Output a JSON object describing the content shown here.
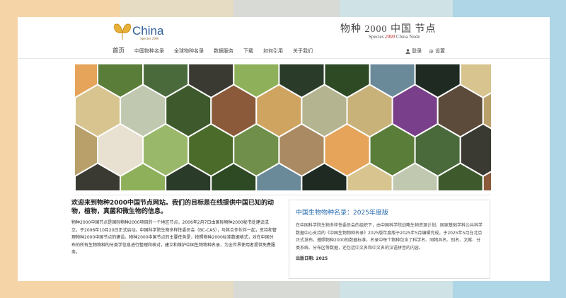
{
  "header": {
    "logo": {
      "text": "China",
      "subtitle": "Species 2000"
    },
    "brand": {
      "title": "物种 2000 中国 节点",
      "subtitle_prefix": "Species",
      "subtitle_num": "2000",
      "subtitle_suffix": "China Node"
    }
  },
  "nav": {
    "items": [
      "首页",
      "中国物种名录",
      "全球物种名录",
      "数据服务",
      "下载",
      "如何引用",
      "关于我们"
    ],
    "login": "登录",
    "settings": "设置"
  },
  "banner": {
    "colors": [
      "#3e5a2c",
      "#b9a06a",
      "#5b7d3a",
      "#1e2a22",
      "#c9b27a",
      "#6f8f4a",
      "#2b3b2a",
      "#8a5a3a",
      "#e8e0d0",
      "#4a6a3c",
      "#d7c48f",
      "#7a3f8a",
      "#a98a62",
      "#2d4a24",
      "#cfa460",
      "#9ab86a",
      "#3a3a32",
      "#c0c8b0",
      "#5c4a3a",
      "#e6a45a",
      "#6a8a9a",
      "#b4b490",
      "#4b6b2b",
      "#8fb05a"
    ]
  },
  "welcome": {
    "title": "欢迎来到物种2000中国节点网站。我们的目标是在线提供中国已知的动物，植物，真菌和微生物的信息。",
    "body": "物种2000中国节点是国际物种2000项目的一个地区节点，2006年2月7日由国际物种2000秘书处建议成立，于2006年10月20日正式启动。中国科学院生物多样性委员会（BC-CAS），与其合作伙伴一起，支持和管理物种2000中国节点的建设。物种2000中国节点的主要任务是，按照物种2000标准数据格式，对在中国分布的所有生物物种的分类学信息进行整理和核对，建立和维护中国生物物种名录，为全世界使用者提供免费服务。"
  },
  "news": {
    "title": "中国生物物种名录：2025年度版",
    "body": "在中国科学院生物多样性委员会的组织下，由中国科学院战略生物资源计划、国家基础学科公共科学数据中心支持的《中国生物物种名录》2025版年度版于2025年5月编辑完成，于2025年5月在北京正式发布。遵照物种2000的数据标准，名录中每个物种包含了科学名、同物异名、别名、文献、分类系统、分布区等数据，还包括中文名和中文名的汉语拼音的内容。",
    "date_label": "出版日期:",
    "date_value": "2025"
  }
}
